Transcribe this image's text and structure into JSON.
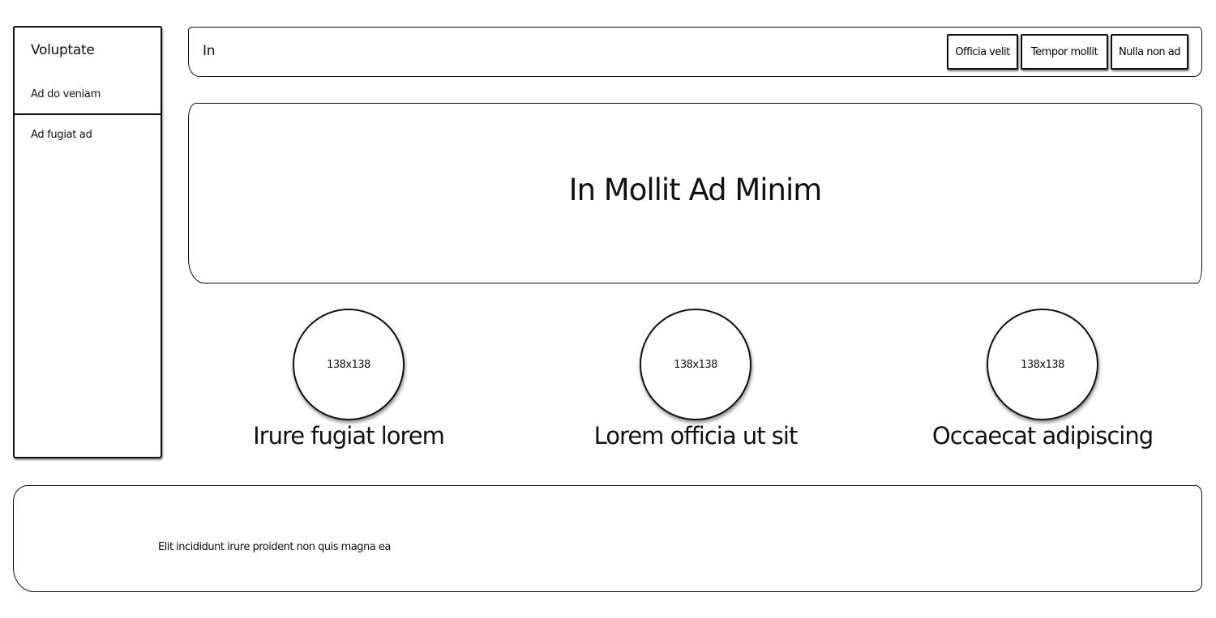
{
  "sidebar": {
    "title": "Voluptate",
    "items": [
      {
        "label": "Ad do veniam"
      },
      {
        "label": "Ad fugiat ad"
      }
    ]
  },
  "header": {
    "title": "In",
    "buttons": [
      {
        "label": "Officia velit"
      },
      {
        "label": "Tempor mollit"
      },
      {
        "label": "Nulla non ad"
      }
    ]
  },
  "hero": {
    "title": "In Mollit Ad Minim"
  },
  "features": [
    {
      "image_label": "138x138",
      "title": "Irure fugiat lorem"
    },
    {
      "image_label": "138x138",
      "title": "Lorem officia ut sit"
    },
    {
      "image_label": "138x138",
      "title": "Occaecat adipiscing"
    }
  ],
  "footer": {
    "text": "Elit incididunt irure proident non quis magna ea"
  }
}
